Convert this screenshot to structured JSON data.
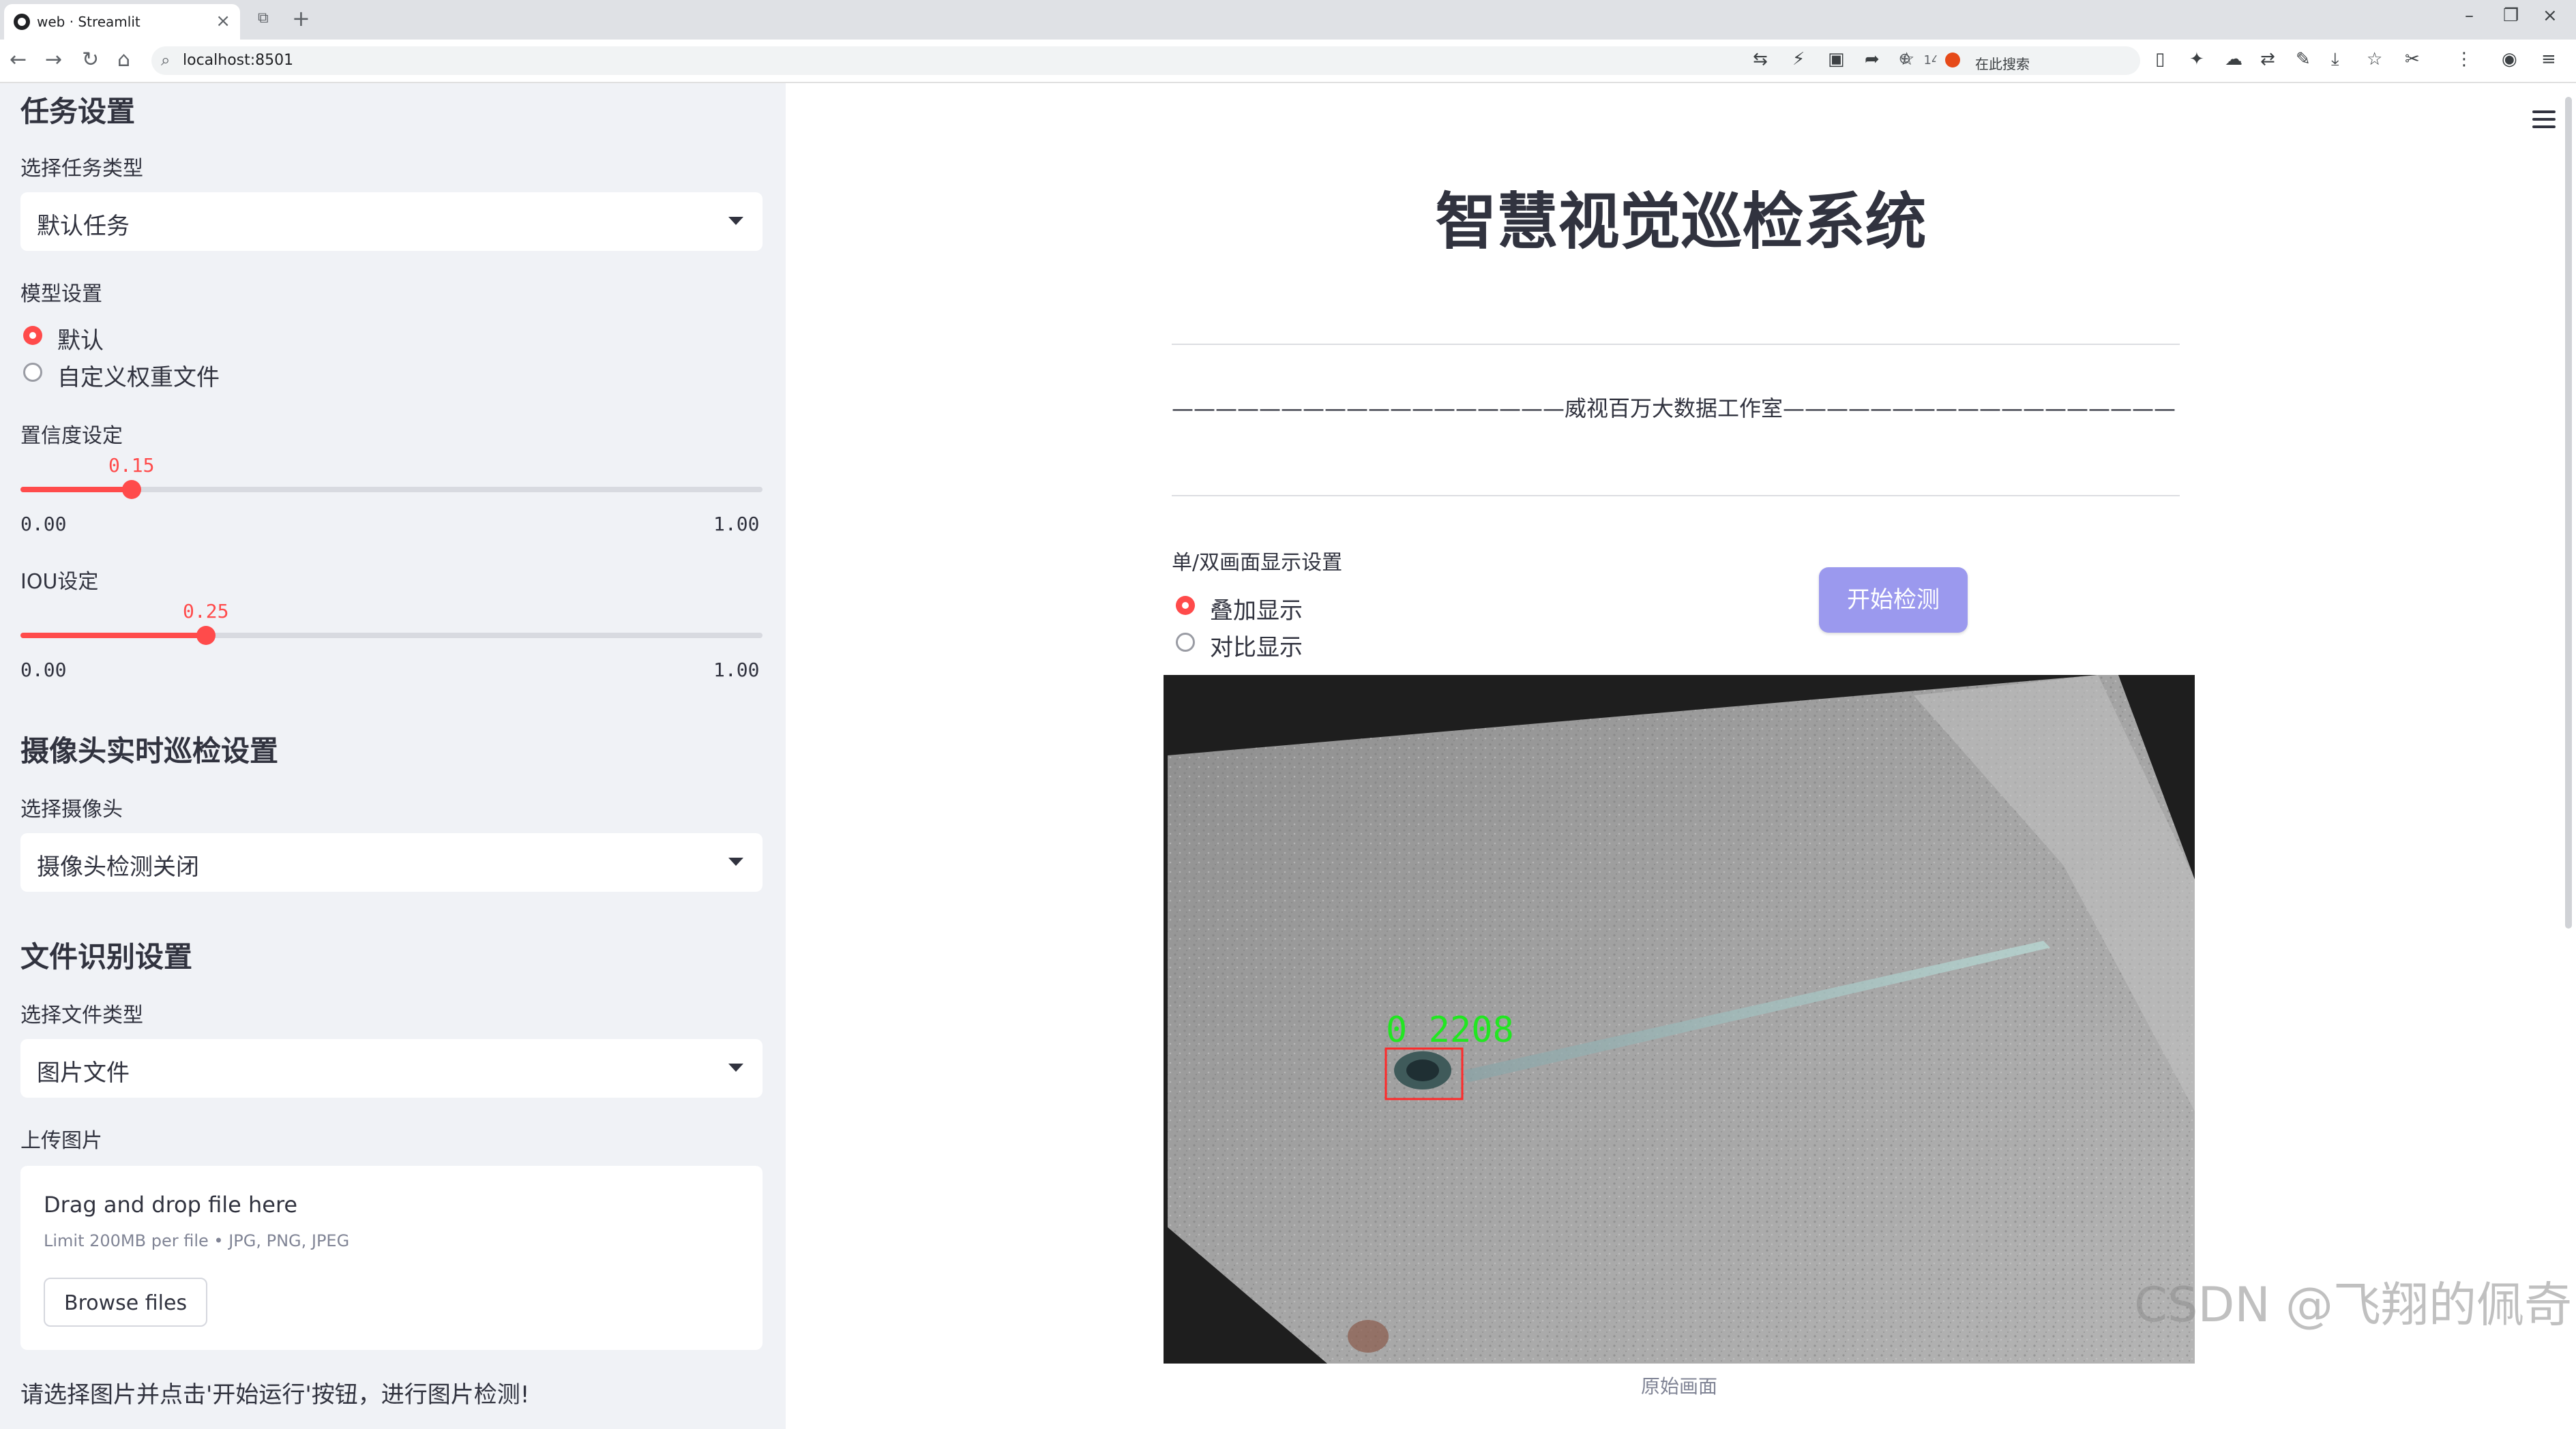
{
  "browser": {
    "tab_title": "web · Streamlit",
    "url": "localhost:8501",
    "zoom": "140%",
    "search_engine_text": "在此搜索"
  },
  "sidebar": {
    "task_section_title": "任务设置",
    "task_type_label": "选择任务类型",
    "task_type_value": "默认任务",
    "model_label": "模型设置",
    "model_options": [
      {
        "label": "默认",
        "selected": true
      },
      {
        "label": "自定义权重文件",
        "selected": false
      }
    ],
    "confidence": {
      "label": "置信度设定",
      "value": "0.15",
      "min": "0.00",
      "max": "1.00",
      "fraction": 0.15
    },
    "iou": {
      "label": "IOU设定",
      "value": "0.25",
      "min": "0.00",
      "max": "1.00",
      "fraction": 0.25
    },
    "camera_section_title": "摄像头实时巡检设置",
    "camera_label": "选择摄像头",
    "camera_value": "摄像头检测关闭",
    "file_section_title": "文件识别设置",
    "file_type_label": "选择文件类型",
    "file_type_value": "图片文件",
    "upload_label": "上传图片",
    "uploader": {
      "title": "Drag and drop file here",
      "limit": "Limit 200MB per file • JPG, PNG, JPEG",
      "button": "Browse files"
    },
    "hint": "请选择图片并点击'开始运行'按钮，进行图片检测!"
  },
  "main": {
    "title": "智慧视觉巡检系统",
    "subtitle": "——————————————————威视百万大数据工作室——————————————————",
    "display_label": "单/双画面显示设置",
    "display_options": [
      {
        "label": "叠加显示",
        "selected": true
      },
      {
        "label": "对比显示",
        "selected": false
      }
    ],
    "start_button": "开始检测",
    "detection_label": "0 2208",
    "caption": "原始画面"
  },
  "watermark": "CSDN @飞翔的佩奇",
  "colors": {
    "accent": "#ff4b4b",
    "button": "#9b99ee",
    "detection_box": "#ff2a2a",
    "detection_text": "#22e622"
  }
}
